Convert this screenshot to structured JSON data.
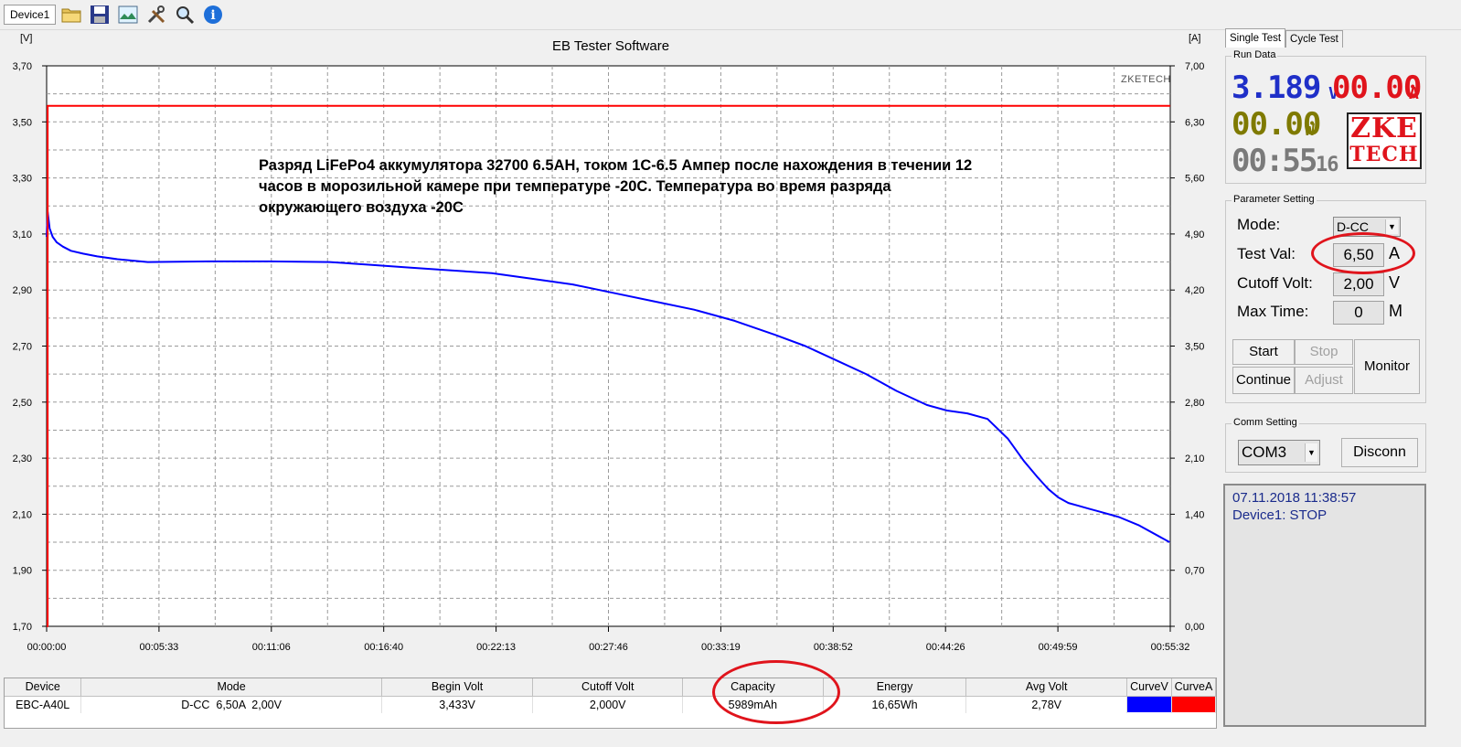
{
  "toolbar": {
    "device_tab": "Device1",
    "icons": [
      "open-folder-icon",
      "save-disk-icon",
      "chart-image-icon",
      "tools-icon",
      "magnifier-icon",
      "info-icon"
    ]
  },
  "chart": {
    "title": "EB Tester Software",
    "y1_unit": "[V]",
    "y2_unit": "[A]",
    "watermark": "ZKETECH",
    "annotation_line1": "Разряд LiFePo4 аккумулятора 32700 6.5AH, током 1С-6.5 Ампер после нахождения в течении 12",
    "annotation_line2": "часов в морозильной камере при температуре -20С. Температура во время разряда",
    "annotation_line3": "окружающего воздуха -20С"
  },
  "chart_data": {
    "type": "line",
    "title": "EB Tester Software",
    "xlabel": "",
    "ylabel": "[V]",
    "y2label": "[A]",
    "x_ticks": [
      "00:00:00",
      "00:05:33",
      "00:11:06",
      "00:16:40",
      "00:22:13",
      "00:27:46",
      "00:33:19",
      "00:38:52",
      "00:44:26",
      "00:49:59",
      "00:55:32"
    ],
    "y_ticks": [
      "3,70",
      "3,50",
      "3,30",
      "3,10",
      "2,90",
      "2,70",
      "2,50",
      "2,30",
      "2,10",
      "1,90",
      "1,70"
    ],
    "y2_ticks": [
      "7,00",
      "6,30",
      "5,60",
      "4,90",
      "4,20",
      "3,50",
      "2,80",
      "2,10",
      "1,40",
      "0,70",
      "0,00"
    ],
    "ylim": [
      1.7,
      3.7
    ],
    "y2lim": [
      0,
      7
    ],
    "xlim_min": [
      0,
      55.533
    ],
    "grid": true,
    "series": [
      {
        "name": "CurveV",
        "axis": "left",
        "color": "#0000ff",
        "x_min": [
          0,
          0.05,
          0.15,
          0.3,
          0.5,
          0.8,
          1.2,
          1.8,
          2.5,
          3.5,
          5,
          8,
          11,
          14,
          16,
          18,
          20,
          22,
          24,
          26,
          28,
          30,
          32,
          34,
          36,
          37.5,
          39,
          40.5,
          42,
          43.5,
          44.5,
          45.5,
          46.5,
          47.5,
          48.3,
          49,
          49.5,
          50,
          50.5,
          51,
          51.5,
          52,
          53,
          54,
          55.5
        ],
        "y": [
          3.09,
          3.18,
          3.12,
          3.09,
          3.07,
          3.055,
          3.04,
          3.03,
          3.02,
          3.01,
          3.0,
          3.002,
          3.002,
          3.0,
          2.99,
          2.98,
          2.97,
          2.96,
          2.94,
          2.92,
          2.89,
          2.86,
          2.83,
          2.79,
          2.74,
          2.7,
          2.65,
          2.6,
          2.54,
          2.49,
          2.47,
          2.46,
          2.44,
          2.37,
          2.29,
          2.23,
          2.19,
          2.16,
          2.14,
          2.13,
          2.12,
          2.11,
          2.09,
          2.06,
          2.0
        ]
      },
      {
        "name": "CurveA",
        "axis": "right",
        "color": "#ff0000",
        "x_min": [
          0,
          0.05,
          0.05,
          55.533
        ],
        "y": [
          0,
          0,
          6.5,
          6.5
        ]
      }
    ]
  },
  "table": {
    "headers": [
      "Device",
      "Mode",
      "Begin Volt",
      "Cutoff Volt",
      "Capacity",
      "Energy",
      "Avg Volt",
      "CurveV",
      "CurveA"
    ],
    "row": [
      "EBC-A40L",
      "D-CC  6,50A  2,00V",
      "3,433V",
      "2,000V",
      "5989mAh",
      "16,65Wh",
      "2,78V"
    ],
    "curve_colors": [
      "#0000ff",
      "#ff0000"
    ]
  },
  "panel": {
    "tabs": [
      "Single Test",
      "Cycle Test"
    ],
    "run_data": {
      "title": "Run Data",
      "volt": "3.189",
      "volt_unit": "V",
      "amp": "00.00",
      "amp_unit": "A",
      "watt": "00.00",
      "watt_unit": "W",
      "time": "00:55",
      "seconds": "16",
      "logo_line1": "ZKE",
      "logo_line2": "TECH"
    },
    "params": {
      "title": "Parameter Setting",
      "mode_label": "Mode:",
      "mode_value": "D-CC",
      "test_val_label": "Test Val:",
      "test_val": "6,50",
      "test_val_unit": "A",
      "cutoff_label": "Cutoff Volt:",
      "cutoff_val": "2,00",
      "cutoff_unit": "V",
      "max_time_label": "Max Time:",
      "max_time_val": "0",
      "max_time_unit": "M",
      "start": "Start",
      "stop": "Stop",
      "continue": "Continue",
      "adjust": "Adjust",
      "monitor": "Monitor"
    },
    "comm": {
      "title": "Comm Setting",
      "port": "COM3",
      "disconn": "Disconn"
    },
    "log": {
      "line1": "07.11.2018 11:38:57",
      "line2": "Device1: STOP"
    }
  }
}
